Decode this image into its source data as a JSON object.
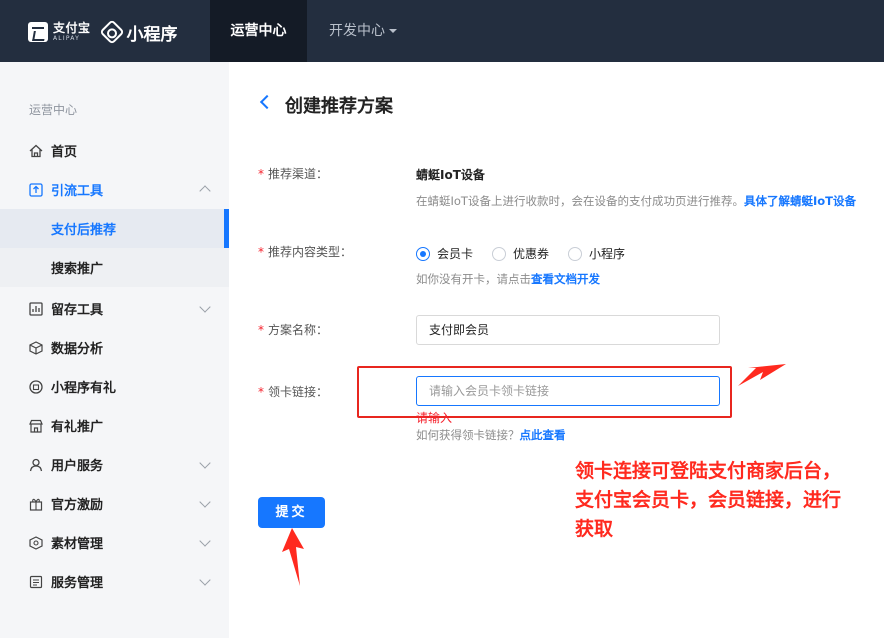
{
  "topbar": {
    "alipay_cn": "支付宝",
    "alipay_en": "ALIPAY",
    "product": "小程序",
    "nav_ops": "运营中心",
    "nav_dev": "开发中心"
  },
  "sidebar": {
    "section": "运营中心",
    "items": [
      {
        "label": "首页",
        "icon": "home-icon"
      },
      {
        "label": "引流工具",
        "icon": "traffic-icon",
        "expanded": true
      },
      {
        "label": "支付后推荐",
        "active": true
      },
      {
        "label": "搜索推广"
      },
      {
        "label": "留存工具",
        "icon": "chart-icon"
      },
      {
        "label": "数据分析",
        "icon": "cube-icon"
      },
      {
        "label": "小程序有礼",
        "icon": "gift-icon"
      },
      {
        "label": "有礼推广",
        "icon": "store-icon"
      },
      {
        "label": "用户服务",
        "icon": "user-icon"
      },
      {
        "label": "官方激励",
        "icon": "reward-icon"
      },
      {
        "label": "素材管理",
        "icon": "material-icon"
      },
      {
        "label": "服务管理",
        "icon": "service-icon"
      }
    ]
  },
  "form": {
    "title": "创建推荐方案",
    "channel_label": "推荐渠道：",
    "channel_value": "蜻蜓IoT设备",
    "channel_hint": "在蜻蜓IoT设备上进行收款时，会在设备的支付成功页进行推荐。",
    "channel_hint_link": "具体了解蜻蜓IoT设备",
    "type_label": "推荐内容类型：",
    "type_options": [
      "会员卡",
      "优惠券",
      "小程序"
    ],
    "type_selected": "会员卡",
    "type_hint": "如你没有开卡，请点击",
    "type_hint_link": "查看文档开发",
    "name_label": "方案名称：",
    "name_value": "支付即会员",
    "link_label": "领卡链接：",
    "link_placeholder": "请输入会员卡领卡链接",
    "link_error": "请输入",
    "link_hint": "如何获得领卡链接？",
    "link_hint_link": "点此查看",
    "submit": "提交"
  },
  "annotation": {
    "lines": [
      "领卡连接可登陆支付商家后台，",
      "支付宝会员卡，会员链接，进行",
      "获取"
    ],
    "color": "#ff2a1f"
  },
  "colors": {
    "topbar": "#232e3f",
    "accent": "#1677ff",
    "error": "#f5222d"
  }
}
